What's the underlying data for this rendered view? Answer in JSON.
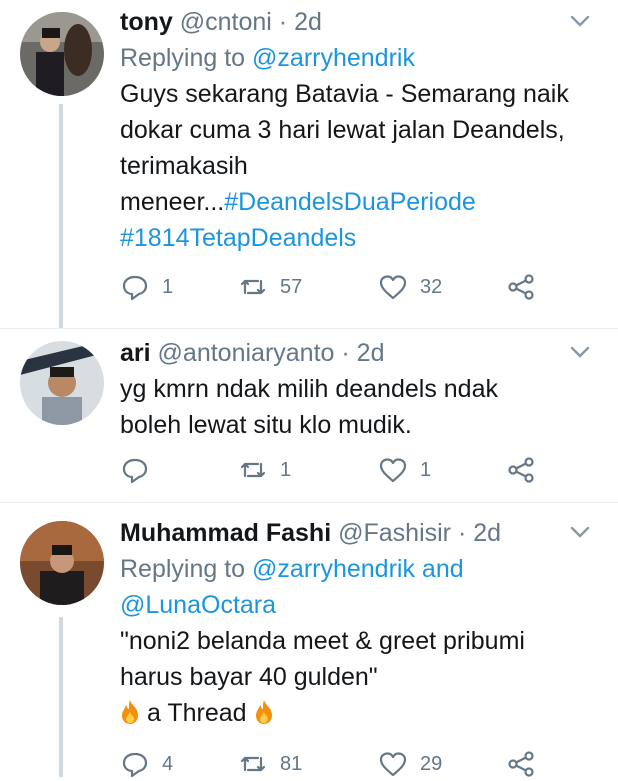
{
  "tweets": [
    {
      "name": "tony",
      "handle": "@cntoni",
      "dot": "·",
      "time": "2d",
      "replying_prefix": "Replying to ",
      "replying_handles": [
        "@zarryhendrik"
      ],
      "lines": [
        "Guys sekarang Batavia - Semarang naik",
        "dokar cuma 3 hari lewat jalan Deandels,",
        "terimakasih"
      ],
      "line4_text": "meneer...",
      "hashtag1": "#DeandelsDuaPeriode",
      "hashtag2": "#1814TetapDeandels",
      "replies": "1",
      "retweets": "57",
      "likes": "32"
    },
    {
      "name": "ari",
      "handle": "@antoniaryanto",
      "dot": "·",
      "time": "2d",
      "lines": [
        "yg kmrn ndak milih deandels ndak",
        "boleh lewat situ klo mudik."
      ],
      "replies": "",
      "retweets": "1",
      "likes": "1"
    },
    {
      "name": "Muhammad Fashi",
      "handle": "@Fashisir",
      "dot": "·",
      "time": "2d",
      "replying_prefix": "Replying to ",
      "replying_handles": [
        "@zarryhendrik",
        "@LunaOctara"
      ],
      "replying_joiner": " and",
      "lines": [
        "\"noni2 belanda meet & greet pribumi",
        "harus bayar 40 gulden\""
      ],
      "thread_text": "a Thread",
      "replies": "4",
      "retweets": "81",
      "likes": "29"
    }
  ],
  "colors": {
    "link": "#1b95e0",
    "muted": "#657786",
    "text": "#14171a"
  }
}
